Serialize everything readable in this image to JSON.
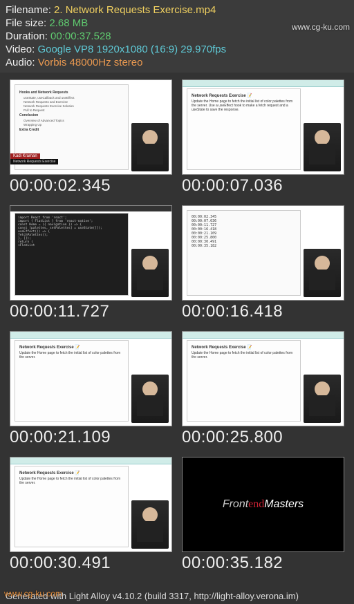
{
  "watermarks": {
    "top_right": "www.cg-ku.com",
    "bottom_left": "www.cg-ku.com"
  },
  "header": {
    "filename_label": "Filename: ",
    "filename_value": "2. Network Requests Exercise.mp4",
    "filesize_label": "File size: ",
    "filesize_value": "2.68 MB",
    "duration_label": "Duration: ",
    "duration_value": "00:00:37.528",
    "video_label": "Video: ",
    "video_value": "Google VP8 1920x1080 (16:9) 29.970fps",
    "audio_label": "Audio: ",
    "audio_value": "Vorbis 48000Hz stereo"
  },
  "thumbs": [
    {
      "timestamp": "00:00:02.345",
      "kind": "outline",
      "nameplate_name": "Kadi Kraman",
      "nameplate_sub": "Network Requests Exercise",
      "outline": {
        "section1": "Hooks and Network Requests",
        "items1": [
          "useState, useCallback and useEffect",
          "Network Requests and Exercise",
          "Network Requests Exercise Solution",
          "Pull to Request"
        ],
        "section2": "Conclusion",
        "items2": [
          "Overview of Advanced Topics",
          "Wrapping Up"
        ],
        "section3": "Extra Credit"
      }
    },
    {
      "timestamp": "00:00:07.036",
      "kind": "docpage",
      "title": "Network Requests Exercise 📝",
      "body": "Update the Home page to fetch the initial list of color palettes from the server. Use a useEffect hook to make a fetch request and a useState to save the response."
    },
    {
      "timestamp": "00:00:11.727",
      "kind": "code",
      "lines": [
        "import React from 'react';",
        "import { FlatList } from 'react-native';",
        "const Home = ({ navigation }) => {",
        "  const [palettes, setPalettes] = useState([]);",
        "  useEffect(() => {",
        "    fetchPalettes();",
        "  }, []);",
        "  return (",
        "    <FlatList"
      ]
    },
    {
      "timestamp": "00:00:16.418",
      "kind": "timestamps",
      "lines": [
        "00:00:02.345",
        "00:00:07.036",
        "00:00:11.727",
        "00:00:16.418",
        "00:00:21.109",
        "00:00:25.800",
        "00:00:30.491",
        "00:00:35.182"
      ]
    },
    {
      "timestamp": "00:00:21.109",
      "kind": "docpage",
      "title": "Network Requests Exercise 📝",
      "body": "Update the Home page to fetch the initial list of color palettes from the server."
    },
    {
      "timestamp": "00:00:25.800",
      "kind": "docpage",
      "title": "Network Requests Exercise 📝",
      "body": "Update the Home page to fetch the initial list of color palettes from the server."
    },
    {
      "timestamp": "00:00:30.491",
      "kind": "docpage",
      "title": "Network Requests Exercise 📝",
      "body": "Update the Home page to fetch the initial list of color palettes from the server."
    },
    {
      "timestamp": "00:00:35.182",
      "kind": "fmlogo",
      "logo_front": "Front",
      "logo_end": "end",
      "logo_masters": "Masters"
    }
  ],
  "footer": "Generated with Light Alloy v4.10.2 (build 3317, http://light-alloy.verona.im)"
}
